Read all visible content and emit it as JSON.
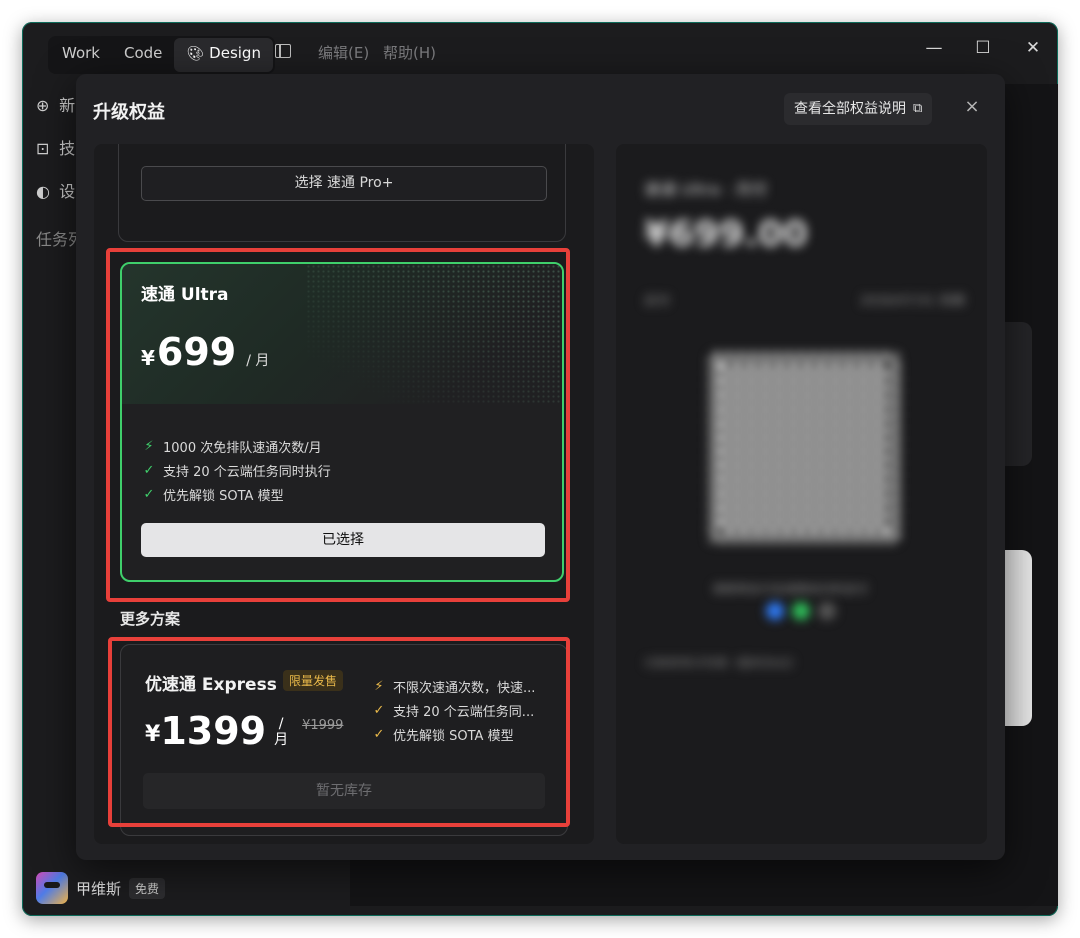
{
  "titlebar": {
    "tabs": [
      "Work",
      "Code",
      "Design"
    ],
    "active_tab": "Design",
    "menus": [
      "编辑(E)",
      "帮助(H)"
    ],
    "window_controls": {
      "minimize": "—",
      "maximize": "☐",
      "close": "✕"
    }
  },
  "sidebar": {
    "items": [
      {
        "icon": "new-chat-icon",
        "glyph": "⊕",
        "label": "新"
      },
      {
        "icon": "book-icon",
        "glyph": "⊡",
        "label": "技"
      },
      {
        "icon": "settings-icon",
        "glyph": "◐",
        "label": "设"
      }
    ],
    "section_label": "任务列"
  },
  "user": {
    "name": "甲维斯",
    "plan_badge": "免费"
  },
  "modal": {
    "title": "升级权益",
    "benefits_button": "查看全部权益说明",
    "close": "×",
    "proplus": {
      "button": "选择 速通 Pro+"
    },
    "ultra": {
      "name": "速通 Ultra",
      "currency": "¥",
      "price": "699",
      "per": "/ 月",
      "features": [
        {
          "icon": "bolt-icon",
          "glyph": "⚡",
          "text": "1000 次免排队速通次数/月"
        },
        {
          "icon": "check-icon",
          "glyph": "✓",
          "text": "支持 20 个云端任务同时执行"
        },
        {
          "icon": "check-icon",
          "glyph": "✓",
          "text": "优先解锁 SOTA 模型"
        }
      ],
      "button": "已选择",
      "accent": "#3fcf6b"
    },
    "more_label": "更多方案",
    "express": {
      "name": "优速通 Express",
      "badge": "限量发售",
      "currency": "¥",
      "price": "1399",
      "per_top": "/",
      "per_bottom": "月",
      "old_price": "¥1999",
      "features": [
        {
          "icon": "bolt-icon",
          "glyph": "⚡",
          "text": "不限次速通次数，快速..."
        },
        {
          "icon": "check-icon",
          "glyph": "✓",
          "text": "支持 20 个云端任务同..."
        },
        {
          "icon": "check-icon",
          "glyph": "✓",
          "text": "优先解锁 SOTA 模型"
        }
      ],
      "button": "暂无库存",
      "accent": "#e9b94a"
    },
    "payment": {
      "title": "速通 Ultra · 月付",
      "price": "¥699.00",
      "row_left": "应付",
      "row_right": "2026/07/31 到期",
      "note": "请使用支付宝或微信扫码支付",
      "footer": "付款即表示同意《服务协议》"
    }
  },
  "colors": {
    "highlight": "#e8403a",
    "window_bg": "#1c1c1e",
    "modal_bg": "#212124"
  }
}
